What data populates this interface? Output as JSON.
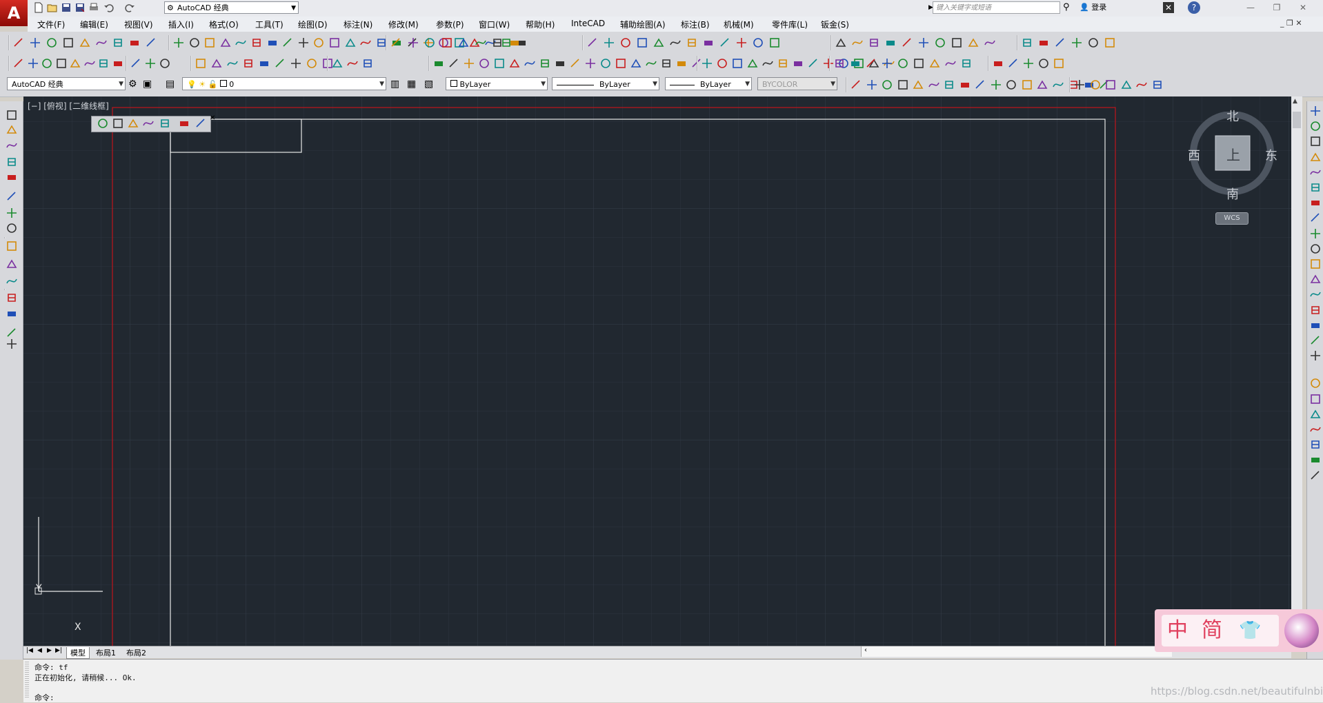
{
  "app": {
    "logo_letter": "A",
    "workspace": "AutoCAD 经典",
    "search_placeholder": "键入关键字或短语",
    "login": "登录"
  },
  "menu": [
    "文件(F)",
    "编辑(E)",
    "视图(V)",
    "插入(I)",
    "格式(O)",
    "工具(T)",
    "绘图(D)",
    "标注(N)",
    "修改(M)",
    "参数(P)",
    "窗口(W)",
    "帮助(H)",
    "InteCAD",
    "辅助绘图(A)",
    "标注(B)",
    "机械(M)",
    "零件库(L)",
    "钣金(S)"
  ],
  "properties": {
    "workspace2": "AutoCAD 经典",
    "layer": "0",
    "color": "ByLayer",
    "linetype": "ByLayer",
    "lineweight": "ByLayer",
    "plotstyle": "BYCOLOR"
  },
  "viewport": {
    "label": "[−] [俯视] [二维线框]"
  },
  "viewcube": {
    "north": "北",
    "south": "南",
    "east": "东",
    "west": "西",
    "top": "上",
    "wcs": "WCS"
  },
  "ucs": {
    "x": "X",
    "y": "Y"
  },
  "tabs": [
    "模型",
    "布局1",
    "布局2"
  ],
  "command": {
    "line1": "命令: tf",
    "line2": "正在初始化, 请稍候... Ok.",
    "prompt": "命令:"
  },
  "ime": {
    "chars": [
      "中",
      "简"
    ]
  },
  "watermark": "https://blog.csdn.net/beautifulnbilo",
  "colors": {
    "canvas": "#212830",
    "grid": "#2b333d",
    "limits_red": "#c0141b",
    "border_white": "#e8e8e8",
    "accent_red": "#d42b22"
  }
}
